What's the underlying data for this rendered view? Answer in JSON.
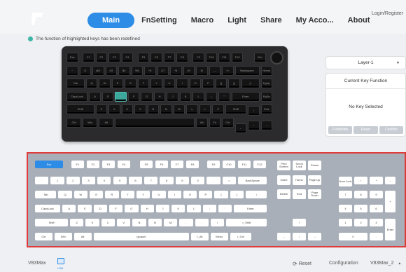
{
  "nav": {
    "tabs": [
      "Main",
      "FnSetting",
      "Macro",
      "Light",
      "Share",
      "My Acco...",
      "About"
    ],
    "active_index": 0,
    "login": "Login/Register"
  },
  "notice": "The function of highlighted keys has been redefined",
  "layer": {
    "value": "Layer-1"
  },
  "key_function": {
    "title": "Current Key Function",
    "status": "No Key Selected",
    "buttons": [
      "Forbidden",
      "Reset",
      "Confirm"
    ]
  },
  "physical_keyboard": {
    "rows": [
      [
        "Esc",
        "F1",
        "F2",
        "F3",
        "F4",
        "F5",
        "F6",
        "F7",
        "F8",
        "F9",
        "F10",
        "F11",
        "F12",
        "Del"
      ],
      [
        "~",
        "!1",
        "@2",
        "#3",
        "$4",
        "%5",
        "^6",
        "&7",
        "*8",
        "(9",
        ")0",
        "_-",
        "+=",
        "Backspace",
        "Home"
      ],
      [
        "Tab",
        "Q",
        "W",
        "E",
        "R",
        "T",
        "Y",
        "U",
        "I",
        "O",
        "P",
        "{[",
        "}]",
        "|\\",
        "PgUp"
      ],
      [
        "CapsLock",
        "A",
        "S",
        "D",
        "F",
        "G",
        "H",
        "J",
        "K",
        "L",
        ":;",
        "\"'",
        "Enter",
        "PgDn"
      ],
      [
        "Shift",
        "Z",
        "X",
        "C",
        "V",
        "B",
        "N",
        "M",
        "<,",
        ">.",
        "?/",
        "Shift",
        "↑",
        "End"
      ],
      [
        "Ctrl",
        "Win",
        "Alt",
        "",
        "Alt",
        "Fn",
        "Ctrl",
        "←",
        "↓",
        "→"
      ]
    ],
    "highlighted": "D"
  },
  "virtual_keyboard": {
    "selected": "Esc",
    "row_fn": [
      "Esc",
      "F1",
      "F2",
      "F3",
      "F4",
      "F5",
      "F6",
      "F7",
      "F8",
      "F9",
      "F10",
      "F11",
      "F12"
    ],
    "row_num": [
      "`",
      "1",
      "2",
      "3",
      "4",
      "5",
      "6",
      "7",
      "8",
      "9",
      "0",
      "-",
      "=",
      "BackSpace"
    ],
    "row_tab": [
      "Tab",
      "Q",
      "W",
      "E",
      "R",
      "T",
      "Y",
      "U",
      "I",
      "O",
      "P",
      "[",
      "]",
      "\\"
    ],
    "row_caps": [
      "CapsLock",
      "A",
      "S",
      "D",
      "F",
      "G",
      "H",
      "J",
      "K",
      "L",
      ";",
      "'",
      "Enter"
    ],
    "row_shift": [
      "Shift",
      "Z",
      "X",
      "C",
      "V",
      "B",
      "N",
      "M",
      ",",
      ".",
      "/",
      "r_Shift"
    ],
    "row_ctrl": [
      "Ctrl",
      "Win",
      "Alt",
      "(space)",
      "r_Alt",
      "Menu",
      "r_Ctrl"
    ],
    "nav_top": [
      "Print Screen",
      "Scroll Lock",
      "Pause"
    ],
    "nav_mid": [
      "Insert",
      "Home",
      "Page Up"
    ],
    "nav_bot": [
      "Delete",
      "End",
      "Page Down"
    ],
    "arrows": [
      "↑",
      "←",
      "↓",
      "→"
    ],
    "numpad": [
      "Num Lock",
      "/",
      "*",
      "-",
      "7",
      "8",
      "9",
      "+",
      "4",
      "5",
      "6",
      "1",
      "2",
      "3",
      "Enter",
      "0",
      "."
    ]
  },
  "footer": {
    "model": "V83Max",
    "usb": "USB",
    "reset": "Reset",
    "configuration": "Configuration",
    "config_value": "V83Max_2"
  }
}
